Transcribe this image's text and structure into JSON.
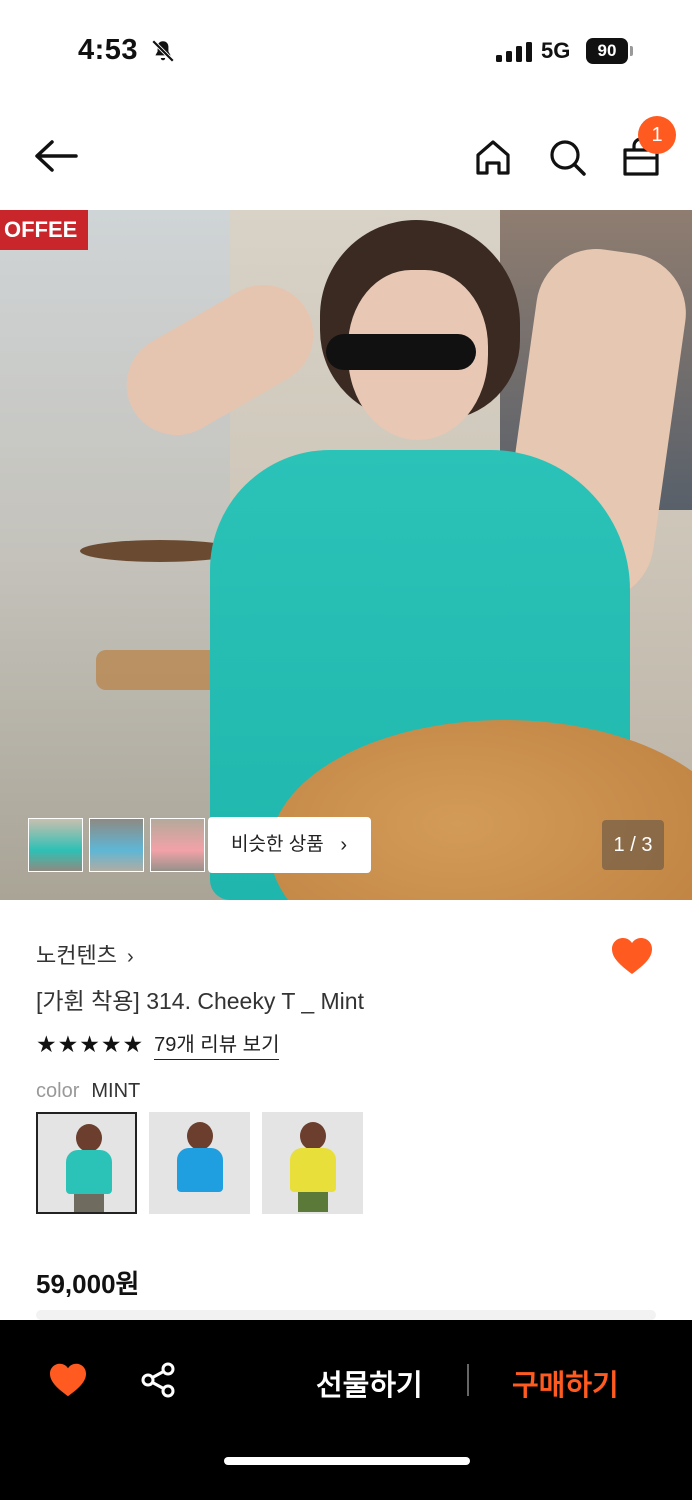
{
  "status_bar": {
    "time": "4:53",
    "network": "5G",
    "battery": "90"
  },
  "nav": {
    "cart_count": "1",
    "icons": [
      "back-arrow-icon",
      "home-icon",
      "search-icon",
      "shopping-bag-icon"
    ]
  },
  "hero": {
    "sign_text": "OFFEE",
    "similar_label": "비슷한 상품",
    "pager": "1 / 3"
  },
  "product": {
    "brand": "노컨텐츠",
    "title": "[가휜 착용] 314. Cheeky T _ Mint",
    "stars": "★★★★★",
    "review_link": "79개 리뷰 보기",
    "color_label": "color",
    "color_value": "MINT",
    "swatches": [
      "mint",
      "blue",
      "yellow"
    ],
    "price": "59,000원"
  },
  "bottom_bar": {
    "gift_label": "선물하기",
    "buy_label": "구매하기"
  },
  "colors": {
    "accent": "#ff5a1f",
    "bottom_bar_bg": "#000000",
    "mint": "#2bc3b8"
  }
}
